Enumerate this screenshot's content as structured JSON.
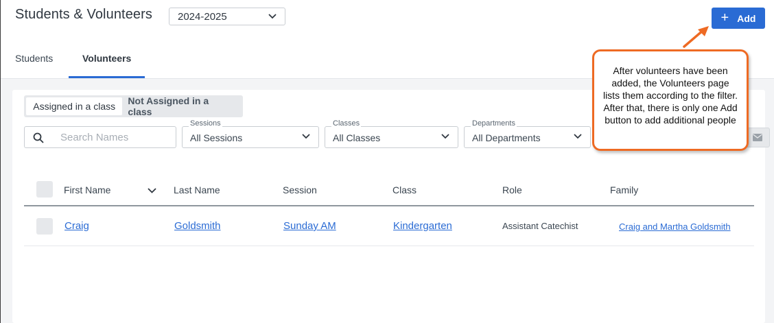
{
  "header": {
    "title": "Students & Volunteers",
    "year_selected": "2024-2025",
    "add_label": "Add",
    "add_icon": "plus-icon"
  },
  "tabs": [
    {
      "label": "Students",
      "active": false
    },
    {
      "label": "Volunteers",
      "active": true
    }
  ],
  "segment": {
    "options": [
      "Assigned in a class",
      "Not Assigned in a class"
    ],
    "selected": "Assigned in a class"
  },
  "filters": {
    "search_placeholder": "Search Names",
    "sessions": {
      "label": "Sessions",
      "value": "All Sessions"
    },
    "classes": {
      "label": "Classes",
      "value": "All Classes"
    },
    "departments": {
      "label": "Departments",
      "value": "All Departments"
    }
  },
  "table": {
    "columns": [
      "First Name",
      "Last Name",
      "Session",
      "Class",
      "Role",
      "Family"
    ],
    "rows": [
      {
        "first_name": "Craig",
        "last_name": "Goldsmith",
        "session": "Sunday AM",
        "class": "Kindergarten",
        "role": "Assistant Catechist",
        "family": "Craig and Martha Goldsmith"
      }
    ]
  },
  "callout": {
    "text": "After volunteers have been added, the Volunteers page lists them according to the filter. After that, there is only one Add button to add additional people"
  },
  "colors": {
    "accent": "#2a6bd4",
    "callout_border": "#ee6a23"
  }
}
